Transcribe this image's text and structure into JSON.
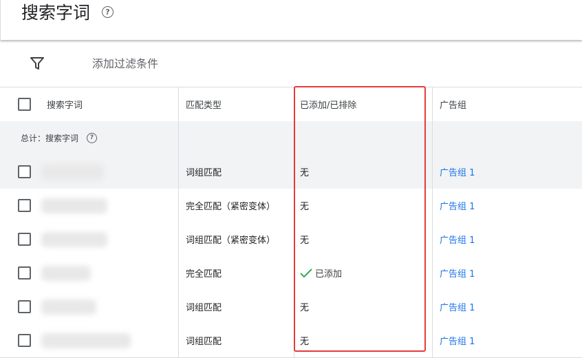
{
  "page": {
    "title": "搜索字词"
  },
  "filter": {
    "label": "添加过滤条件"
  },
  "table": {
    "columns": [
      "搜索字词",
      "匹配类型",
      "已添加/已排除",
      "广告组"
    ],
    "total_label": "总计：搜索字词",
    "rows": [
      {
        "match_type": "词组匹配",
        "status": "无",
        "ad_group": "广告组 1"
      },
      {
        "match_type": "完全匹配（紧密变体）",
        "status": "无",
        "ad_group": "广告组 1"
      },
      {
        "match_type": "词组匹配（紧密变体）",
        "status": "无",
        "ad_group": "广告组 1"
      },
      {
        "match_type": "完全匹配",
        "status": "已添加",
        "ad_group": "广告组 1"
      },
      {
        "match_type": "词组匹配",
        "status": "无",
        "ad_group": "广告组 1"
      },
      {
        "match_type": "词组匹配",
        "status": "无",
        "ad_group": "广告组 1"
      }
    ]
  },
  "colors": {
    "link": "#1a73e8",
    "check": "#34a853",
    "highlight": "#e5393a"
  }
}
